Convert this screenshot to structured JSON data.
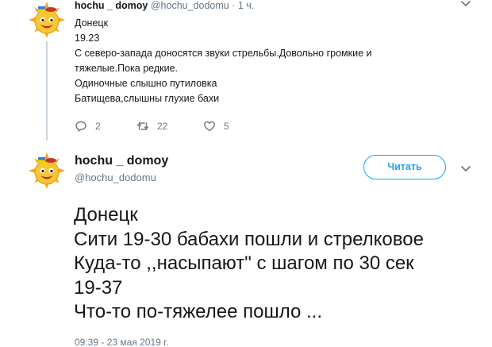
{
  "parent_tweet": {
    "display_name": "hochu _ domoy",
    "handle": "@hochu_dodomu",
    "separator": "·",
    "time": "1 ч.",
    "avatar_icon": "sun-smiley-icon",
    "lines": [
      "Донецк",
      "19.23",
      "С северо-запада доносятся звуки стрельбы.Довольно громкие и",
      "тяжелые.Пока редкие.",
      "Одиночные слышно путиловка",
      "Батищева,слышны глухие бахи"
    ],
    "actions": {
      "reply_count": "2",
      "retweet_count": "22",
      "like_count": "5"
    }
  },
  "main_tweet": {
    "display_name": "hochu _ domoy",
    "handle": "@hochu_dodomu",
    "follow_label": "Читать",
    "avatar_icon": "sun-smiley-icon",
    "lines": [
      "Донецк",
      "Сити 19-30 бабахи пошли и стрелковое",
      "Куда-то ,,насыпают\" с шагом по 30 сек",
      "19-37",
      "Что-то по-тяжелее пошло ..."
    ],
    "timestamp": "09:39 - 23 мая 2019 г."
  },
  "colors": {
    "accent": "#1da1f2",
    "muted_text": "#657786",
    "primary_text": "#14171a",
    "thread_line": "#ccd6dd"
  }
}
